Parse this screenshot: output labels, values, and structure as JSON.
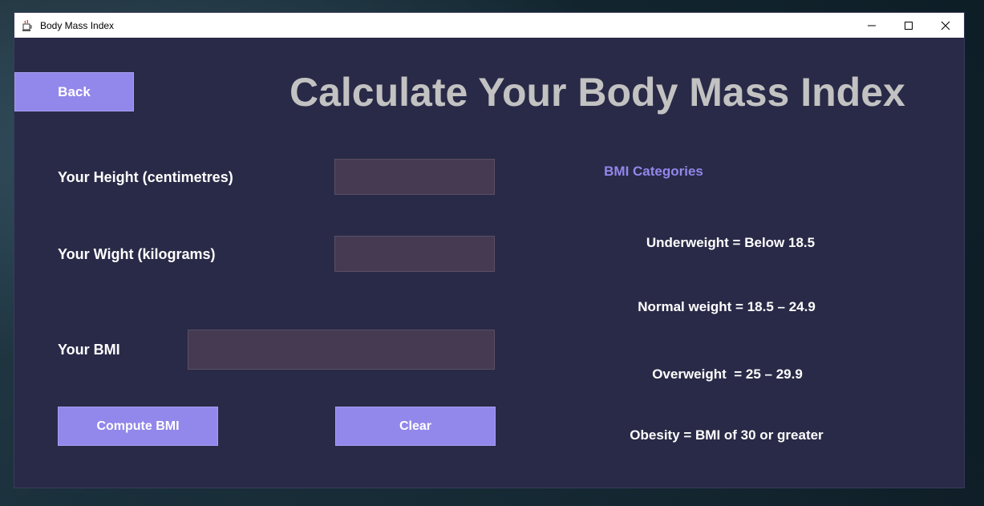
{
  "window": {
    "title": "Body Mass Index"
  },
  "header": {
    "back_label": "Back",
    "title": "Calculate Your Body Mass Index"
  },
  "form": {
    "height_label": "Your Height (centimetres)",
    "height_value": "",
    "weight_label": "Your Wight (kilograms)",
    "weight_value": "",
    "bmi_label": "Your BMI",
    "bmi_value": "",
    "compute_label": "Compute BMI",
    "clear_label": "Clear"
  },
  "categories": {
    "heading": "BMI Categories",
    "items": [
      "Underweight = Below 18.5",
      "Normal weight = 18.5 – 24.9",
      "Overweight  = 25 – 29.9",
      "Obesity = BMI of 30 or greater"
    ]
  },
  "colors": {
    "background": "#292a47",
    "accent": "#9287eb",
    "title": "#c2c2c2",
    "field": "#463a52"
  },
  "icons": {
    "app": "java-cup-icon",
    "minimize": "minimize-icon",
    "maximize": "maximize-icon",
    "close": "close-icon"
  }
}
